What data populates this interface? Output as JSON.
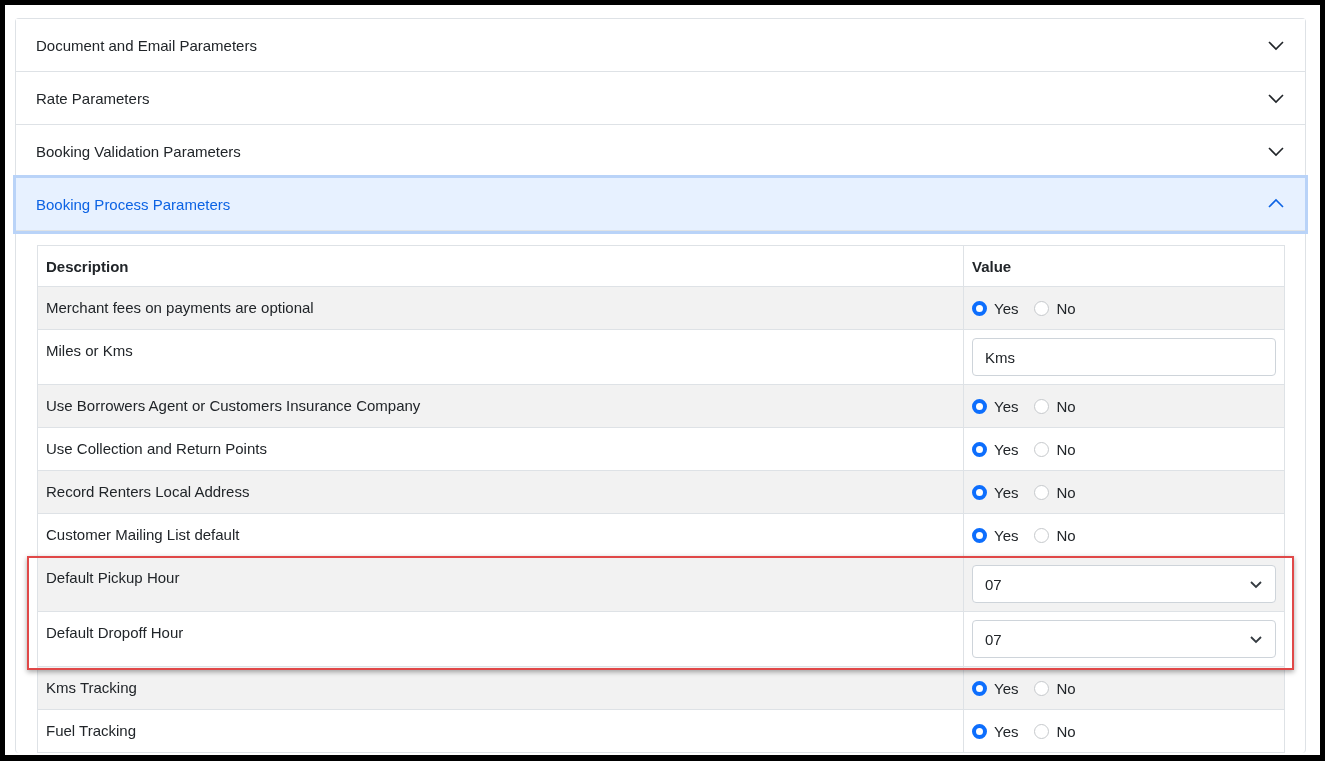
{
  "sections": [
    {
      "title": "Document and Email Parameters",
      "expanded": false
    },
    {
      "title": "Rate Parameters",
      "expanded": false
    },
    {
      "title": "Booking Validation Parameters",
      "expanded": false
    },
    {
      "title": "Booking Process Parameters",
      "expanded": true
    }
  ],
  "table": {
    "columns": [
      "Description",
      "Value"
    ],
    "rows": [
      {
        "description": "Merchant fees on payments are optional",
        "kind": "radio",
        "options": [
          {
            "label": "Yes",
            "selected": true
          },
          {
            "label": "No",
            "selected": false
          }
        ]
      },
      {
        "description": "Miles or Kms",
        "kind": "text",
        "value": "Kms"
      },
      {
        "description": "Use Borrowers Agent or Customers Insurance Company",
        "kind": "radio",
        "options": [
          {
            "label": "Yes",
            "selected": true
          },
          {
            "label": "No",
            "selected": false
          }
        ]
      },
      {
        "description": "Use Collection and Return Points",
        "kind": "radio",
        "options": [
          {
            "label": "Yes",
            "selected": true
          },
          {
            "label": "No",
            "selected": false
          }
        ]
      },
      {
        "description": "Record Renters Local Address",
        "kind": "radio",
        "options": [
          {
            "label": "Yes",
            "selected": true
          },
          {
            "label": "No",
            "selected": false
          }
        ]
      },
      {
        "description": "Customer Mailing List default",
        "kind": "radio",
        "options": [
          {
            "label": "Yes",
            "selected": true
          },
          {
            "label": "No",
            "selected": false
          }
        ]
      },
      {
        "description": "Default Pickup Hour",
        "kind": "select",
        "highlighted": true,
        "value": "07"
      },
      {
        "description": "Default Dropoff Hour",
        "kind": "select",
        "highlighted": true,
        "value": "07"
      },
      {
        "description": "Kms Tracking",
        "kind": "radio",
        "options": [
          {
            "label": "Yes",
            "selected": true
          },
          {
            "label": "No",
            "selected": false
          }
        ]
      },
      {
        "description": "Fuel Tracking",
        "kind": "radio",
        "options": [
          {
            "label": "Yes",
            "selected": true
          },
          {
            "label": "No",
            "selected": false
          }
        ]
      }
    ]
  }
}
